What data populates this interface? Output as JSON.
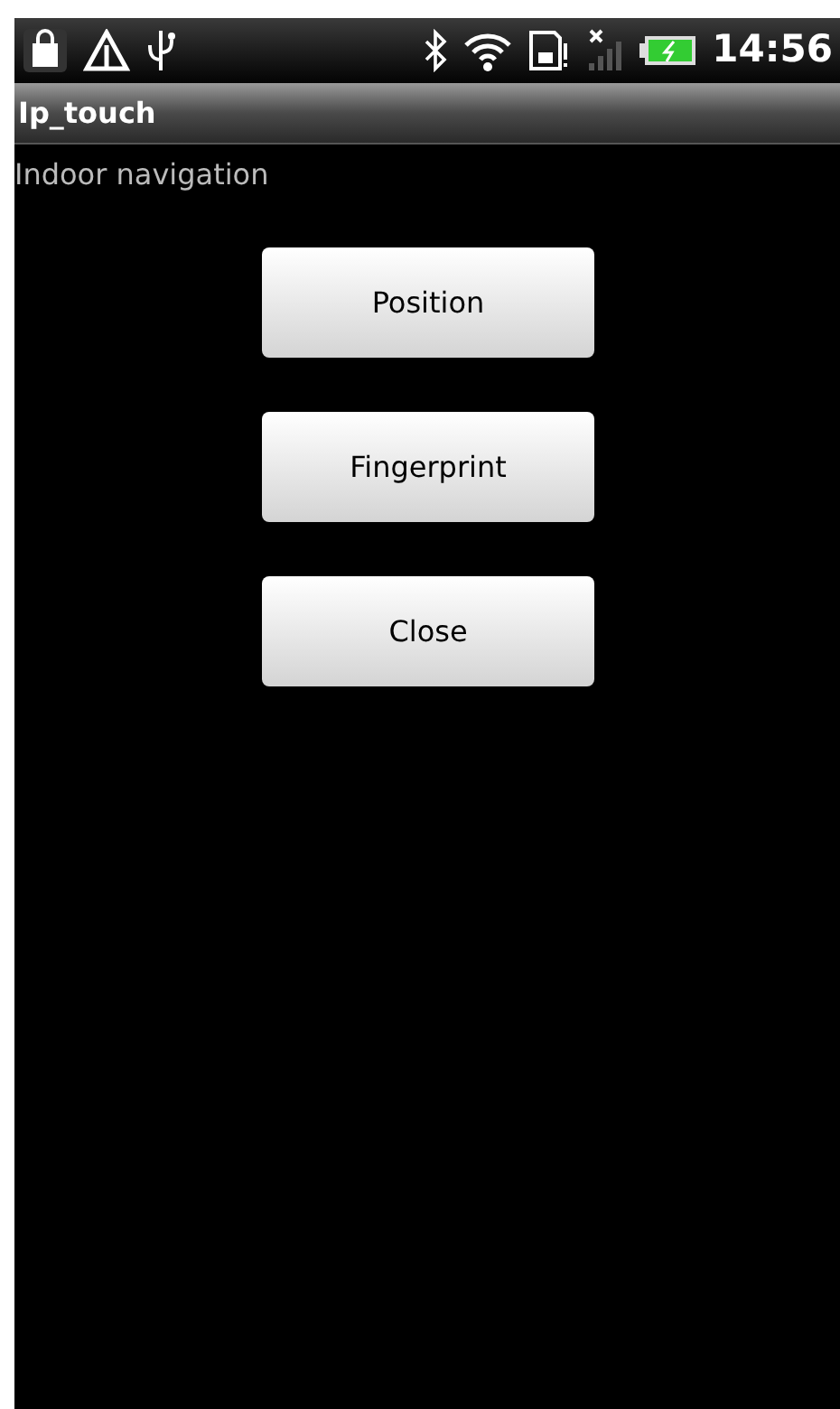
{
  "status_bar": {
    "time": "14:56"
  },
  "title_bar": {
    "title": "Ip_touch"
  },
  "content": {
    "label": "Indoor navigation",
    "buttons": [
      {
        "label": "Position"
      },
      {
        "label": "Fingerprint"
      },
      {
        "label": "Close"
      }
    ]
  }
}
